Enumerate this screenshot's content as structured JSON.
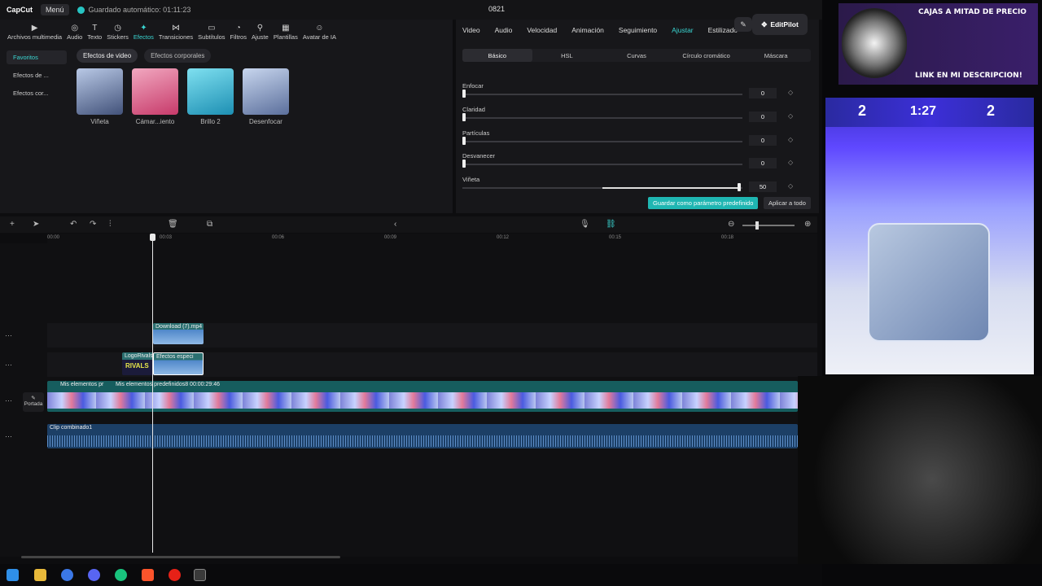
{
  "topbar": {
    "app": "CapCut",
    "menu": "Menú",
    "saved": "Guardado automático: 01:11:23",
    "project": "0821"
  },
  "toolbar": [
    "Archivos multimedia",
    "Audio",
    "Texto",
    "Stickers",
    "Efectos",
    "Transiciones",
    "Subtítulos",
    "Filtros",
    "Ajuste",
    "Plantillas",
    "Avatar de IA"
  ],
  "toolbar_icons": [
    "▶",
    "◎",
    "T",
    "◷",
    "✦",
    "⋈",
    "▭",
    "◔",
    "⚲",
    "▦",
    "☺"
  ],
  "sidebar": [
    "Favoritos",
    "Efectos de ...",
    "Efectos cor..."
  ],
  "effect_tabs": [
    "Efectos de video",
    "Efectos corporales"
  ],
  "effects": [
    {
      "label": "Viñeta",
      "color": "#6e7fa8"
    },
    {
      "label": "Cámar...iento",
      "color": "#d96a8a"
    },
    {
      "label": "Brillo 2",
      "color": "#39b7d8"
    },
    {
      "label": "Desenfocar",
      "color": "#7a8fb8"
    }
  ],
  "right_tabs": [
    "Video",
    "Audio",
    "Velocidad",
    "Animación",
    "Seguimiento",
    "Ajustar",
    "Estilizado"
  ],
  "sub_tabs": [
    "Básico",
    "HSL",
    "Curvas",
    "Círculo cromático",
    "Máscara"
  ],
  "sliders": [
    {
      "label": "Enfocar",
      "value": "0",
      "fraction": 0
    },
    {
      "label": "Claridad",
      "value": "0",
      "fraction": 0
    },
    {
      "label": "Partículas",
      "value": "0",
      "fraction": 0
    },
    {
      "label": "Desvanecer",
      "value": "0",
      "fraction": 0
    },
    {
      "label": "Viñeta",
      "value": "50",
      "fraction": 0.5
    }
  ],
  "buttons": {
    "save_preset": "Guardar como parámetro predefinido",
    "apply_all": "Aplicar a todo"
  },
  "editpilot": "EditPilot",
  "ruler": [
    "00:00",
    "00:03",
    "00:06",
    "00:09",
    "00:12",
    "00:15",
    "00:18"
  ],
  "clips": {
    "top": "Download (7).mp4",
    "logo": "LogoRivals",
    "effect": "Efectos especi",
    "main1": "Mis elementos pr",
    "main2": "Mis elementos predefinidos8   00:00:29:46",
    "audio": "Clip combinado1"
  },
  "portada": "Portada",
  "stream": {
    "promo_line1": "CAJAS A MITAD DE PRECIO",
    "promo_line2": "LINK EN MI DESCRIPCION!",
    "score_left": "2",
    "score_right": "2",
    "timer": "1:27"
  }
}
